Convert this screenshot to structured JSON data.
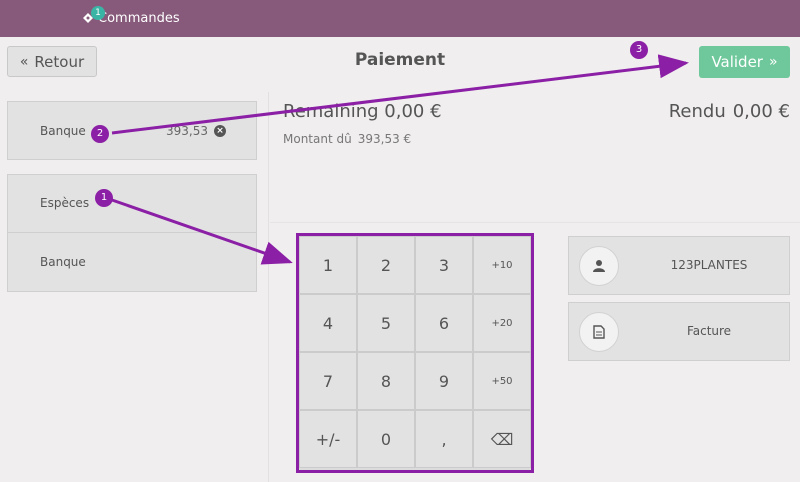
{
  "topbar": {
    "orders_label": "Commandes",
    "orders_count": "1",
    "ticket_icon": "ticket-icon"
  },
  "header": {
    "back_label": "Retour",
    "back_icon": "double-chevron-left-icon",
    "title": "Paiement",
    "validate_label": "Valider",
    "validate_icon": "double-chevron-right-icon"
  },
  "payment_lines": [
    {
      "method": "Banque",
      "amount": "393,53",
      "remove_icon": "close-circle-icon"
    }
  ],
  "payment_methods": [
    "Espèces",
    "Banque"
  ],
  "summary": {
    "remaining_label": "Remaining 0,00 €",
    "due_label": "Montant dû",
    "due_value": "393,53 €",
    "change_label": "Rendu",
    "change_value": "0,00 €"
  },
  "numpad": {
    "keys": [
      "1",
      "2",
      "3",
      "+10",
      "4",
      "5",
      "6",
      "+20",
      "7",
      "8",
      "9",
      "+50",
      "+/-",
      "0",
      ",",
      "⌫"
    ]
  },
  "side_buttons": {
    "customer_label": "123PLANTES",
    "customer_icon": "user-icon",
    "invoice_label": "Facture",
    "invoice_icon": "document-icon"
  },
  "annotations": {
    "markers": [
      "1",
      "2",
      "3"
    ]
  },
  "colors": {
    "topbar": "#875a7b",
    "validate": "#6ec89b",
    "annotation": "#8b1fa5",
    "badge": "#3ab5a5"
  }
}
